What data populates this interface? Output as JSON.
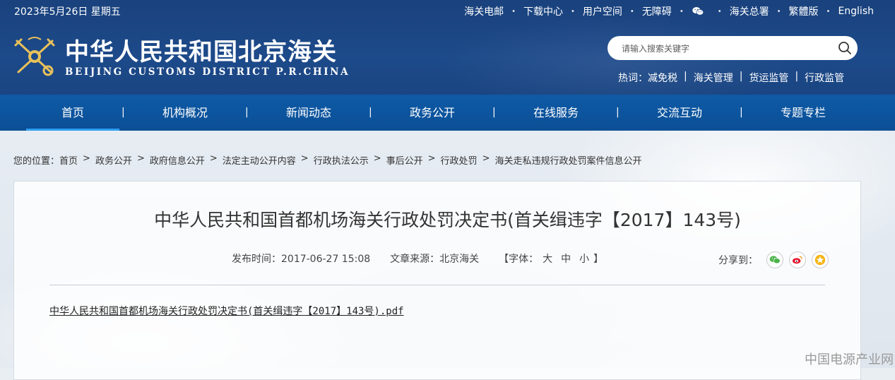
{
  "header": {
    "date": "2023年5月26日 星期五",
    "top_links": [
      "海关电邮",
      "下载中心",
      "用户空间",
      "无障碍"
    ],
    "wechat_icon": "wechat-icon",
    "top_links_right": [
      "海关总署",
      "繁體版",
      "English"
    ],
    "site_name_cn": "中华人民共和国北京海关",
    "site_name_en": "BEIJING CUSTOMS DISTRICT P.R.CHINA",
    "search_placeholder": "请输入搜索关键字",
    "hot_label": "热词：",
    "hot_words": [
      "减免税",
      "海关管理",
      "货运监管",
      "行政监管"
    ]
  },
  "nav": {
    "items": [
      "首页",
      "机构概况",
      "新闻动态",
      "政务公开",
      "在线服务",
      "交流互动",
      "专题专栏"
    ],
    "separator": "|"
  },
  "breadcrumb": {
    "prefix": "您的位置：",
    "items": [
      "首页",
      "政务公开",
      "政府信息公开",
      "法定主动公开内容",
      "行政执法公示",
      "事后公开",
      "行政处罚",
      "海关走私违规行政处罚案件信息公开"
    ],
    "separator": ">"
  },
  "article": {
    "title": "中华人民共和国首都机场海关行政处罚决定书(首关缉违字【2017】143号)",
    "publish_time": "发布时间：2017-06-27 15:08",
    "source": "文章来源：北京海关",
    "font_label_open": "【字体：",
    "font_sizes": [
      "大",
      "中",
      "小"
    ],
    "font_label_close": "】",
    "share_label": "分享到：",
    "attachment": "中华人民共和国首都机场海关行政处罚决定书(首关缉违字【2017】143号).pdf"
  },
  "footer_mark": "中国电源产业网",
  "colors": {
    "header_bg": "#1d4a8a",
    "nav_bg": "#0b4f96",
    "nav_active_underline": "#2c9cf0"
  }
}
